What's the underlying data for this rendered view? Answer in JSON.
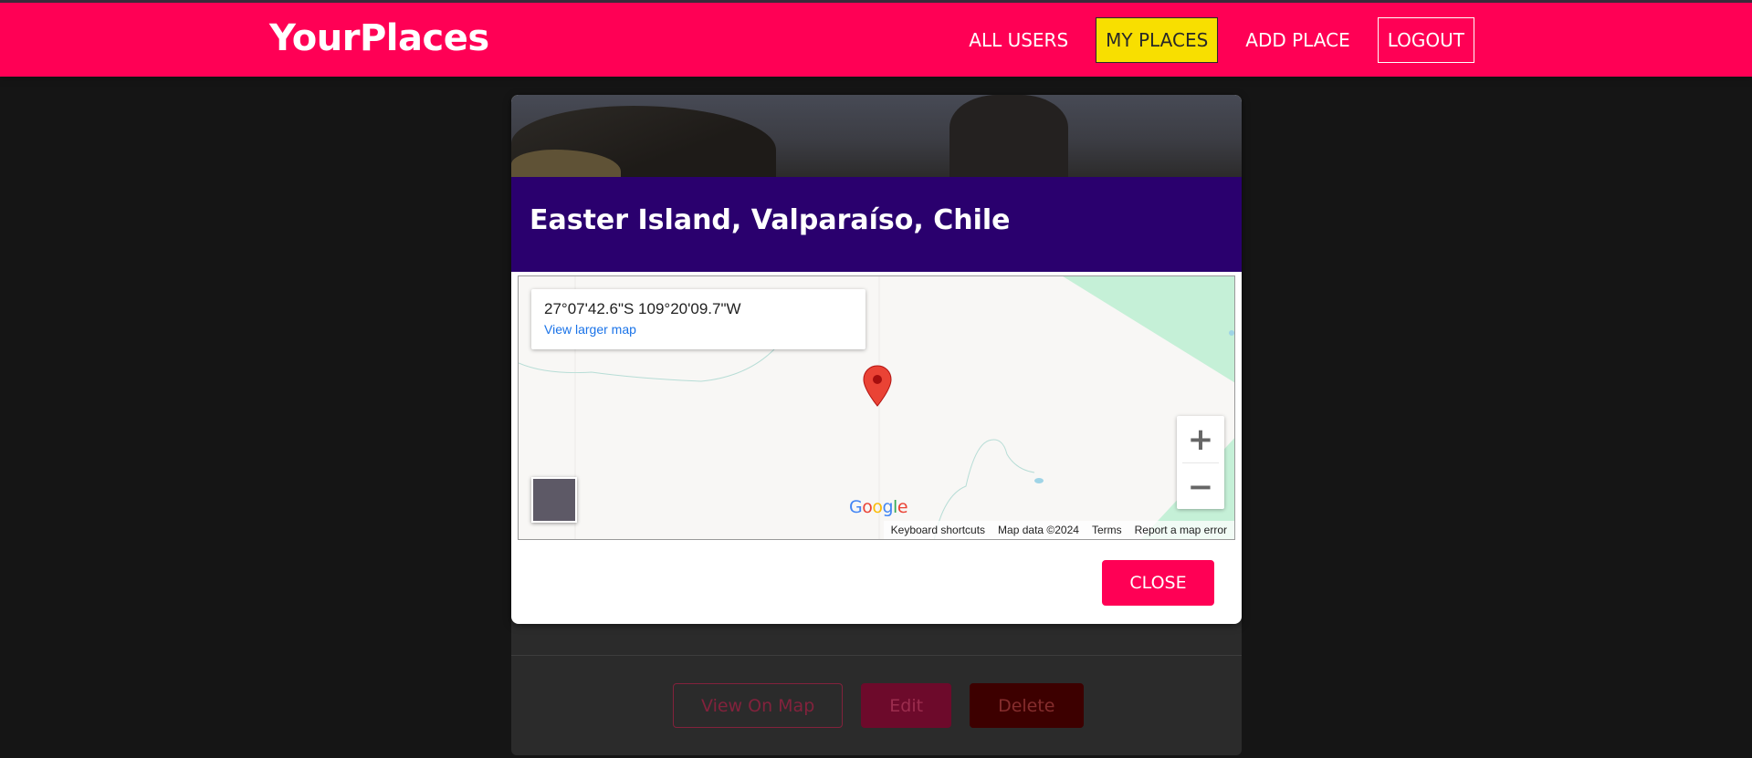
{
  "header": {
    "logo": "YourPlaces",
    "nav": [
      "ALL USERS",
      "MY PLACES",
      "ADD PLACE",
      "LOGOUT"
    ],
    "active_nav": "MY PLACES",
    "brand_color": "#ff0055",
    "active_color": "#f8df00"
  },
  "card": {
    "actions": [
      "View On Map",
      "Edit",
      "Delete"
    ]
  },
  "modal": {
    "title": "Easter Island, Valparaíso, Chile",
    "header_color": "#2a006e",
    "map": {
      "coordinates": "27°07'42.6\"S 109°20'09.7\"W",
      "view_larger_label": "View larger map",
      "zoom_in_label": "+",
      "zoom_out_label": "−",
      "logo_letters": [
        "G",
        "o",
        "o",
        "g",
        "l",
        "e"
      ],
      "logo_colors": [
        "#4285f4",
        "#ea4335",
        "#fbbc05",
        "#4285f4",
        "#34a853",
        "#ea4335"
      ],
      "attribution": [
        "Keyboard shortcuts",
        "Map data ©2024",
        "Terms",
        "Report a map error"
      ],
      "pin_color": "#ea4335",
      "icons": [
        "location-pin-icon",
        "satellite-thumbnail-icon"
      ]
    },
    "close_label": "CLOSE"
  }
}
